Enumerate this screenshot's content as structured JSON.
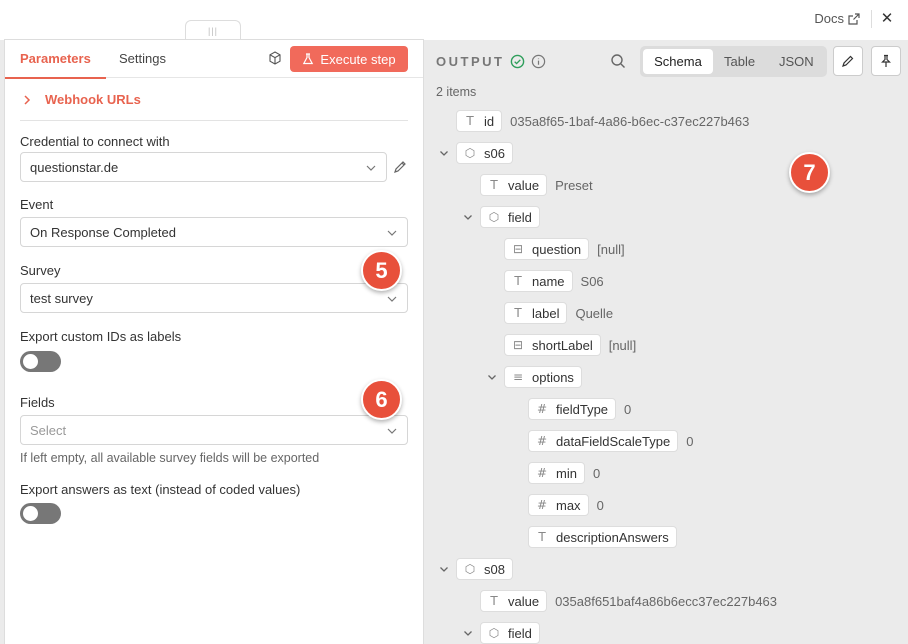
{
  "topbar": {
    "docs_label": "Docs",
    "close_glyph": "✕",
    "drag_glyph": "|||"
  },
  "left": {
    "tabs": {
      "parameters": "Parameters",
      "settings": "Settings"
    },
    "execute_label": "Execute step",
    "webhook_label": "Webhook URLs",
    "credential": {
      "label": "Credential to connect with",
      "value": "questionstar.de"
    },
    "event": {
      "label": "Event",
      "value": "On Response Completed"
    },
    "survey": {
      "label": "Survey",
      "value": "test survey"
    },
    "export_ids": {
      "label": "Export custom IDs as labels",
      "on": false
    },
    "fields": {
      "label": "Fields",
      "placeholder": "Select",
      "hint": "If left empty, all available survey fields will be exported"
    },
    "export_text": {
      "label": "Export answers as text (instead of coded values)",
      "on": false
    }
  },
  "badges": [
    "5",
    "6",
    "7"
  ],
  "output": {
    "title": "OUTPUT",
    "tabs": [
      "Schema",
      "Table",
      "JSON"
    ],
    "items_count": "2 items",
    "schema": [
      {
        "type": "string",
        "key": "id",
        "value": "035a8f65-1baf-4a86-b6ec-c37ec227b463"
      },
      {
        "type": "object",
        "key": "s06",
        "value": ""
      },
      {
        "type": "string",
        "key": "value",
        "value": "Preset"
      },
      {
        "type": "object",
        "key": "field",
        "value": ""
      },
      {
        "type": "null",
        "key": "question",
        "value": "[null]"
      },
      {
        "type": "string",
        "key": "name",
        "value": "S06"
      },
      {
        "type": "string",
        "key": "label",
        "value": "Quelle"
      },
      {
        "type": "null",
        "key": "shortLabel",
        "value": "[null]"
      },
      {
        "type": "array",
        "key": "options",
        "value": ""
      },
      {
        "type": "number",
        "key": "fieldType",
        "value": "0"
      },
      {
        "type": "number",
        "key": "dataFieldScaleType",
        "value": "0"
      },
      {
        "type": "number",
        "key": "min",
        "value": "0"
      },
      {
        "type": "number",
        "key": "max",
        "value": "0"
      },
      {
        "type": "string",
        "key": "descriptionAnswers",
        "value": ""
      },
      {
        "type": "object",
        "key": "s08",
        "value": ""
      },
      {
        "type": "string",
        "key": "value",
        "value": "035a8f651baf4a86b6ecc37ec227b463"
      },
      {
        "type": "object",
        "key": "field",
        "value": ""
      }
    ]
  },
  "colors": {
    "accent": "#e8634f",
    "button": "#f16a5b",
    "badge": "#e8503b",
    "success": "#2e9e5b"
  }
}
